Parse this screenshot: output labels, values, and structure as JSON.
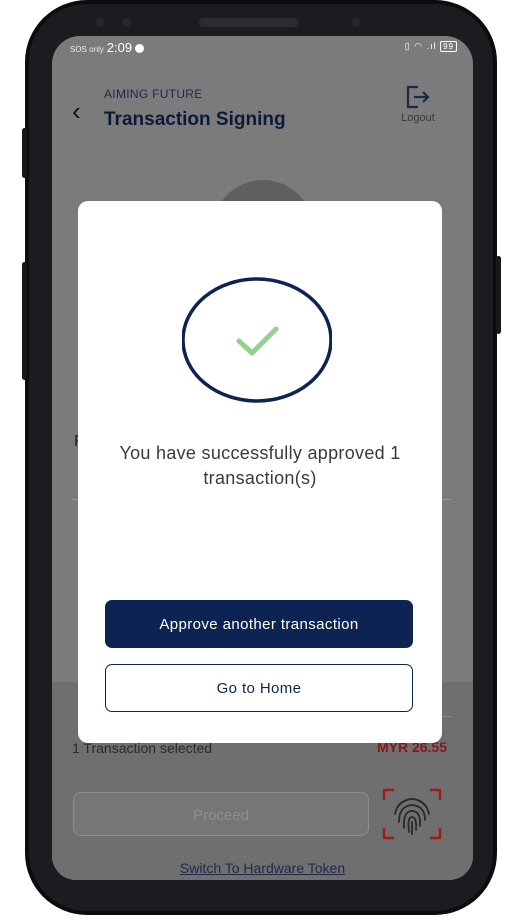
{
  "status_bar": {
    "carrier": "SOS only",
    "time": "2:09",
    "right_icons": "vibrate wifi signal battery 99",
    "battery": "99"
  },
  "header": {
    "app_name": "AIMING FUTURE",
    "title": "Transaction Signing",
    "back_icon": "chevron-left-icon",
    "logout_icon": "logout-icon",
    "logout_label": "Logout"
  },
  "background": {
    "partial_letter": "F"
  },
  "modal": {
    "icon": "check-circle-icon",
    "message": "You have successfully approved 1 transaction(s)",
    "primary_button": "Approve another transaction",
    "secondary_button": "Go to Home"
  },
  "footer": {
    "selected_text": "1 Transaction selected",
    "currency": "MYR",
    "amount": "26.55",
    "proceed_label": "Proceed",
    "fingerprint_icon": "fingerprint-icon",
    "hardware_token_link": "Switch To Hardware Token"
  },
  "colors": {
    "primary": "#0d2453",
    "success": "#8fd48a",
    "amount": "#c0392b"
  }
}
